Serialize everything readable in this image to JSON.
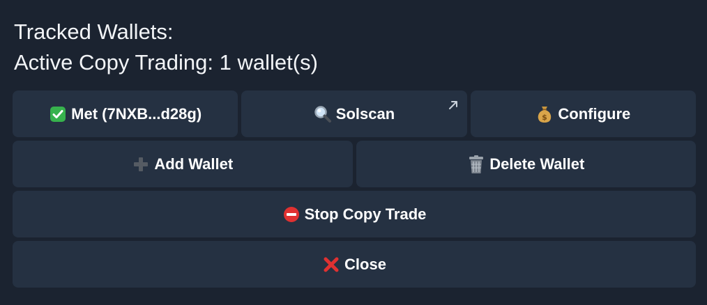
{
  "message": {
    "line1": "Tracked Wallets:",
    "line2": "Active Copy Trading: 1 wallet(s)"
  },
  "buttons": {
    "wallet": {
      "label": "Met (7NXB...d28g)",
      "icon": "check-mark-icon"
    },
    "solscan": {
      "label": "Solscan",
      "icon": "magnifier-icon",
      "external": "external-link-icon"
    },
    "configure": {
      "label": "Configure",
      "icon": "money-bag-icon"
    },
    "add_wallet": {
      "label": "Add Wallet",
      "icon": "plus-icon"
    },
    "delete_wallet": {
      "label": "Delete Wallet",
      "icon": "trash-icon"
    },
    "stop": {
      "label": "Stop Copy Trade",
      "icon": "no-entry-icon"
    },
    "close": {
      "label": "Close",
      "icon": "cross-mark-icon"
    }
  },
  "colors": {
    "background": "#1b2330",
    "button": "#253142",
    "check_green": "#37b24d",
    "stop_red": "#e03131",
    "close_red": "#e03131"
  }
}
